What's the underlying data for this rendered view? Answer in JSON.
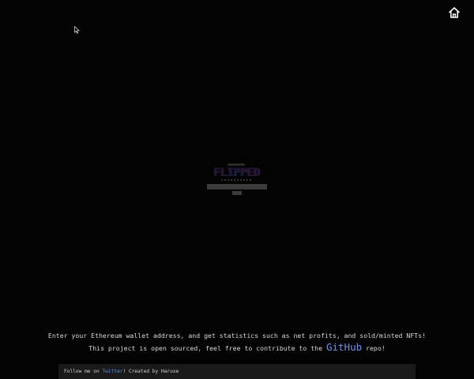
{
  "header": {
    "home_icon": "home-icon"
  },
  "hero": {
    "logo_text": "FLIPPED",
    "search": {
      "value": "",
      "placeholder": ""
    },
    "submit_label": ""
  },
  "description": {
    "line1": "Enter your Ethereum wallet address, and get statistics such as net profits, and sold/minted NFTs!",
    "line2_prefix": "This project is open sourced, feel free to contribute to the ",
    "github_link": "GitHub",
    "line2_suffix": " repo!"
  },
  "footer": {
    "prefix": "Follow me on ",
    "twitter_link": "Twitter",
    "suffix": "! Created by Haruxe"
  },
  "colors": {
    "background": "#030303",
    "text": "#d8d8d8",
    "link": "#6f93e8",
    "footer_bg": "#1a1a1a"
  }
}
